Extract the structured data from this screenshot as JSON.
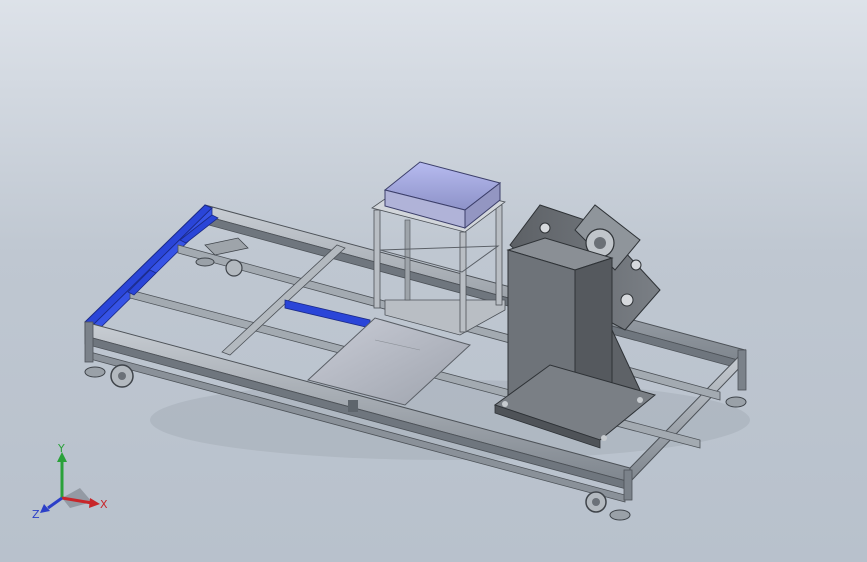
{
  "viewport": {
    "background_top": "#dde2e9",
    "background_bottom": "#b8c1cc"
  },
  "model": {
    "frame_color": "#8d949c",
    "highlight_color": "#2a45d8",
    "cover_color": "#a9afe6"
  },
  "triad": {
    "x_label": "X",
    "y_label": "Y",
    "z_label": "Z",
    "x_color": "#c8262a",
    "y_color": "#2aa13a",
    "z_color": "#2b3fc8"
  }
}
